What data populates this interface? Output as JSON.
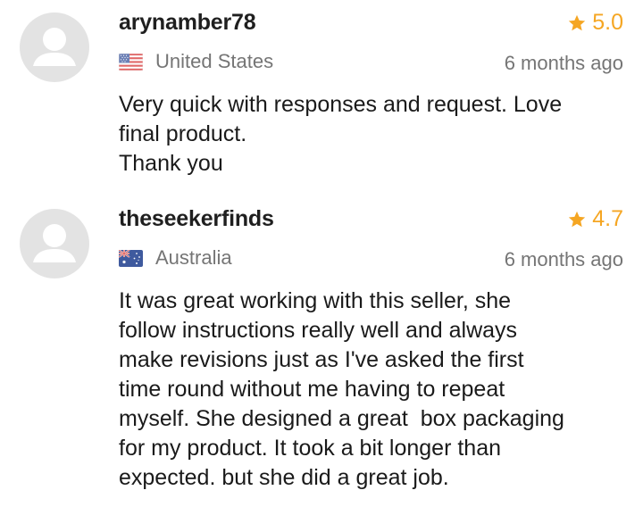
{
  "reviews": [
    {
      "username": "arynamber78",
      "rating": "5.0",
      "country": "United States",
      "country_flag_icon": "us-flag-icon",
      "time_ago": "6 months ago",
      "text": "Very quick with responses and request. Love\nfinal product.\nThank you"
    },
    {
      "username": "theseekerfinds",
      "rating": "4.7",
      "country": "Australia",
      "country_flag_icon": "australia-flag-icon",
      "time_ago": "6 months ago",
      "text": "It was great working with this seller, she\nfollow instructions really well and always\nmake revisions just as I've asked the first\ntime round without me having to repeat\nmyself. She designed a great  box packaging\nfor my product. It took a bit longer than\nexpected. but she did a great job."
    }
  ],
  "colors": {
    "star": "#f5a623",
    "muted_text": "#757575",
    "avatar_bg": "#e3e3e3",
    "avatar_fg": "#ffffff"
  }
}
